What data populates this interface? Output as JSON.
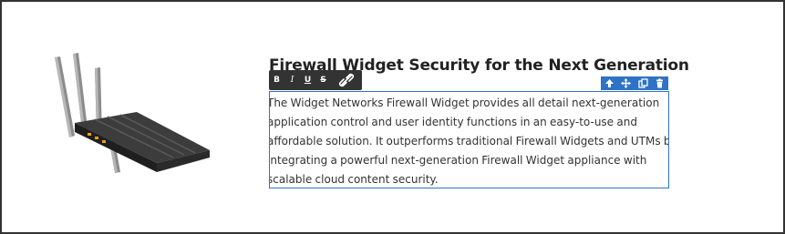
{
  "heading": "Firewall Widget Security for the Next Generation",
  "body_lines": [
    "The Widget Networks Firewall Widget provides all detail next-generation",
    "application control and user identity functions in an easy-to-use and",
    "affordable solution. It outperforms traditional Firewall Widgets and UTMs by",
    "integrating a powerful next-generation Firewall Widget appliance with",
    "scalable cloud content security."
  ],
  "format_toolbar": {
    "bold_label": "B",
    "italic_label": "I",
    "underline_label": "U",
    "strike_label": "S",
    "link_icon": "link-icon"
  },
  "block_toolbar": {
    "icons": [
      "arrow-up-icon",
      "move-icon",
      "duplicate-icon",
      "trash-icon"
    ]
  },
  "colors": {
    "selection_border": "#2f73c4",
    "format_toolbar_bg": "#333333",
    "block_toolbar_bg": "#2f73c4",
    "heading_color": "#222222",
    "body_color": "#333333"
  },
  "image": {
    "icon": "router-icon"
  }
}
